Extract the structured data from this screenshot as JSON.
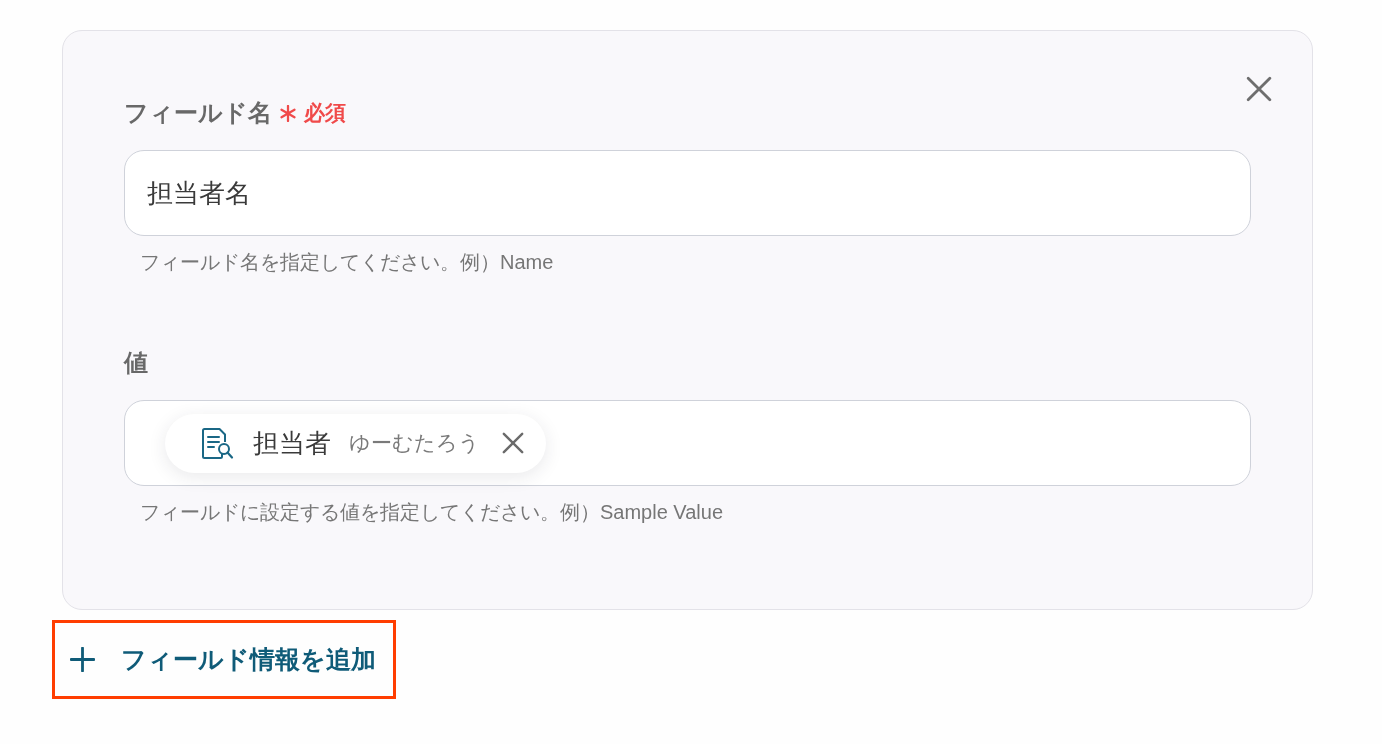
{
  "card": {
    "fields": [
      {
        "kind": "text",
        "label": "フィールド名",
        "required": true,
        "required_label": "必須",
        "value": "担当者名",
        "help": "フィールド名を指定してください。例）Name"
      },
      {
        "kind": "chips",
        "label": "値",
        "required": false,
        "chips": [
          {
            "name": "担当者",
            "value": "ゆーむたろう"
          }
        ],
        "help": "フィールドに設定する値を指定してください。例）Sample Value"
      }
    ]
  },
  "add_button": {
    "label": "フィールド情報を追加",
    "highlighted": true
  }
}
